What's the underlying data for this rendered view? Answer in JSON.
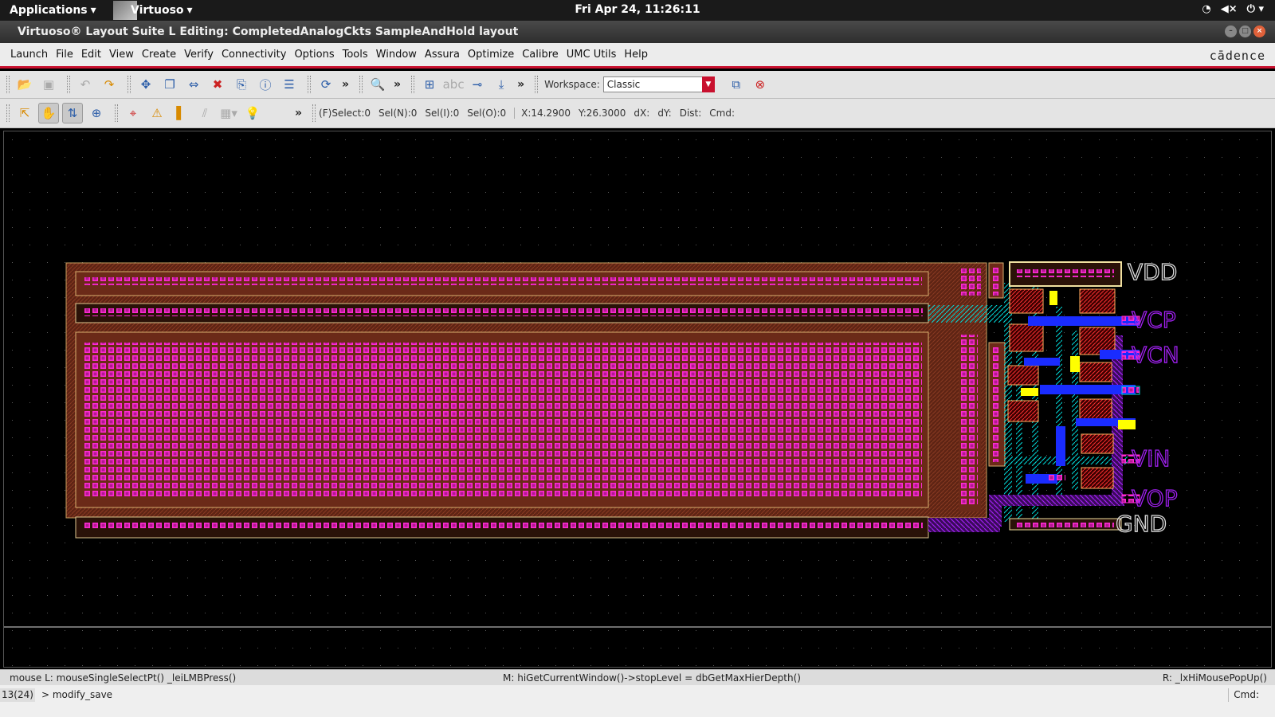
{
  "topbar": {
    "applications": "Applications",
    "virtuoso": "Virtuoso",
    "clock": "Fri Apr 24, 11:26:11",
    "tray_icons": [
      "wifi-icon",
      "volume-icon",
      "power-icon"
    ]
  },
  "window": {
    "title": "Virtuoso® Layout Suite L Editing: CompletedAnalogCkts SampleAndHold layout"
  },
  "menubar": {
    "items": [
      "Launch",
      "File",
      "Edit",
      "View",
      "Create",
      "Verify",
      "Connectivity",
      "Options",
      "Tools",
      "Window",
      "Assura",
      "Optimize",
      "Calibre",
      "UMC Utils",
      "Help"
    ],
    "brand": "cādence"
  },
  "toolbar1": {
    "workspace_label": "Workspace:",
    "workspace_value": "Classic",
    "more": "»"
  },
  "toolbar2": {
    "more": "»",
    "status": {
      "fselect": "(F)Select:0",
      "seln": "Sel(N):0",
      "seli": "Sel(I):0",
      "selo": "Sel(O):0",
      "x": "X:14.2900",
      "y": "Y:26.3000",
      "dx": "dX:",
      "dy": "dY:",
      "dist": "Dist:",
      "cmd": "Cmd:"
    }
  },
  "canvas": {
    "pin_labels": {
      "vdd": "VDD",
      "vcp": "VCP",
      "vcn": "VCN",
      "vin": "VIN",
      "vop": "VOP",
      "gnd": "GND"
    },
    "colors": {
      "background": "#000000",
      "metal_contact": "#ff2ad4",
      "nwell": "#7a2a1a",
      "metal2": "#1a2cff",
      "poly": "#ff3030",
      "via": "#ffff00",
      "metal1": "#00ffff",
      "metal3": "#a020f0",
      "pin_text": "#a020f0"
    }
  },
  "mousebar": {
    "left": "mouse L: mouseSingleSelectPt() _leiLMBPress()",
    "middle": "M: hiGetCurrentWindow()->stopLevel = dbGetMaxHierDepth()",
    "right": "R: _lxHiMousePopUp()"
  },
  "cmdbar": {
    "counter": "13(24)",
    "prompt": "> modify_save",
    "cmd_label": "Cmd:"
  }
}
